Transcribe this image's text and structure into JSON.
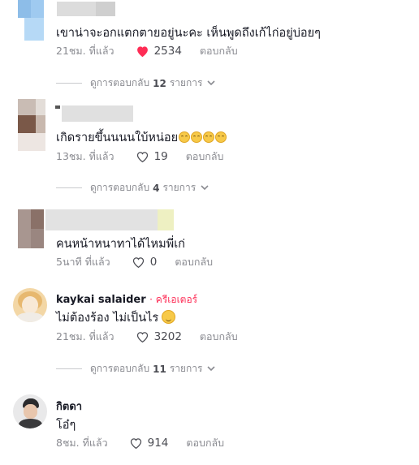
{
  "comments": [
    {
      "text": "เขาน่าจะอกแตกตายอยู่นะคะ เห็นพูดถึงเก้ไก่อยู่บ่อยๆ",
      "time": "21ชม. ที่แล้ว",
      "likes": "2534",
      "liked": true,
      "reply_label": "ตอบกลับ",
      "view_replies": {
        "prefix": "ดูการตอบกลับ",
        "count": "12",
        "suffix": "รายการ"
      }
    },
    {
      "text": "เกิดรายขึ้นนนนใบ้หน่อย",
      "time": "13ชม. ที่แล้ว",
      "likes": "19",
      "liked": false,
      "reply_label": "ตอบกลับ",
      "view_replies": {
        "prefix": "ดูการตอบกลับ",
        "count": "4",
        "suffix": "รายการ"
      }
    },
    {
      "text": "คนหน้าหนาทาได้ไหมพี่เก่",
      "time": "5นาที ที่แล้ว",
      "likes": "0",
      "liked": false,
      "reply_label": "ตอบกลับ"
    },
    {
      "name": "kaykai salaider",
      "creator_badge": "· ครีเอเตอร์",
      "text": "ไม่ต้องร้อง ไม่เป็นไร",
      "time": "21ชม. ที่แล้ว",
      "likes": "3202",
      "liked": false,
      "reply_label": "ตอบกลับ",
      "view_replies": {
        "prefix": "ดูการตอบกลับ",
        "count": "11",
        "suffix": "รายการ"
      }
    },
    {
      "name": "กิตดา",
      "text": "โอ๋ๆ",
      "time": "8ชม. ที่แล้ว",
      "likes": "914",
      "liked": false,
      "reply_label": "ตอบกลับ"
    }
  ],
  "icons": {
    "like": "heart-icon",
    "expand": "chevron-down-icon",
    "emoji": "smiling-face-emoji"
  },
  "colors": {
    "liked_heart": "#fe2c55",
    "creator_badge": "#fe2c55",
    "muted_text": "#8a8b91"
  }
}
